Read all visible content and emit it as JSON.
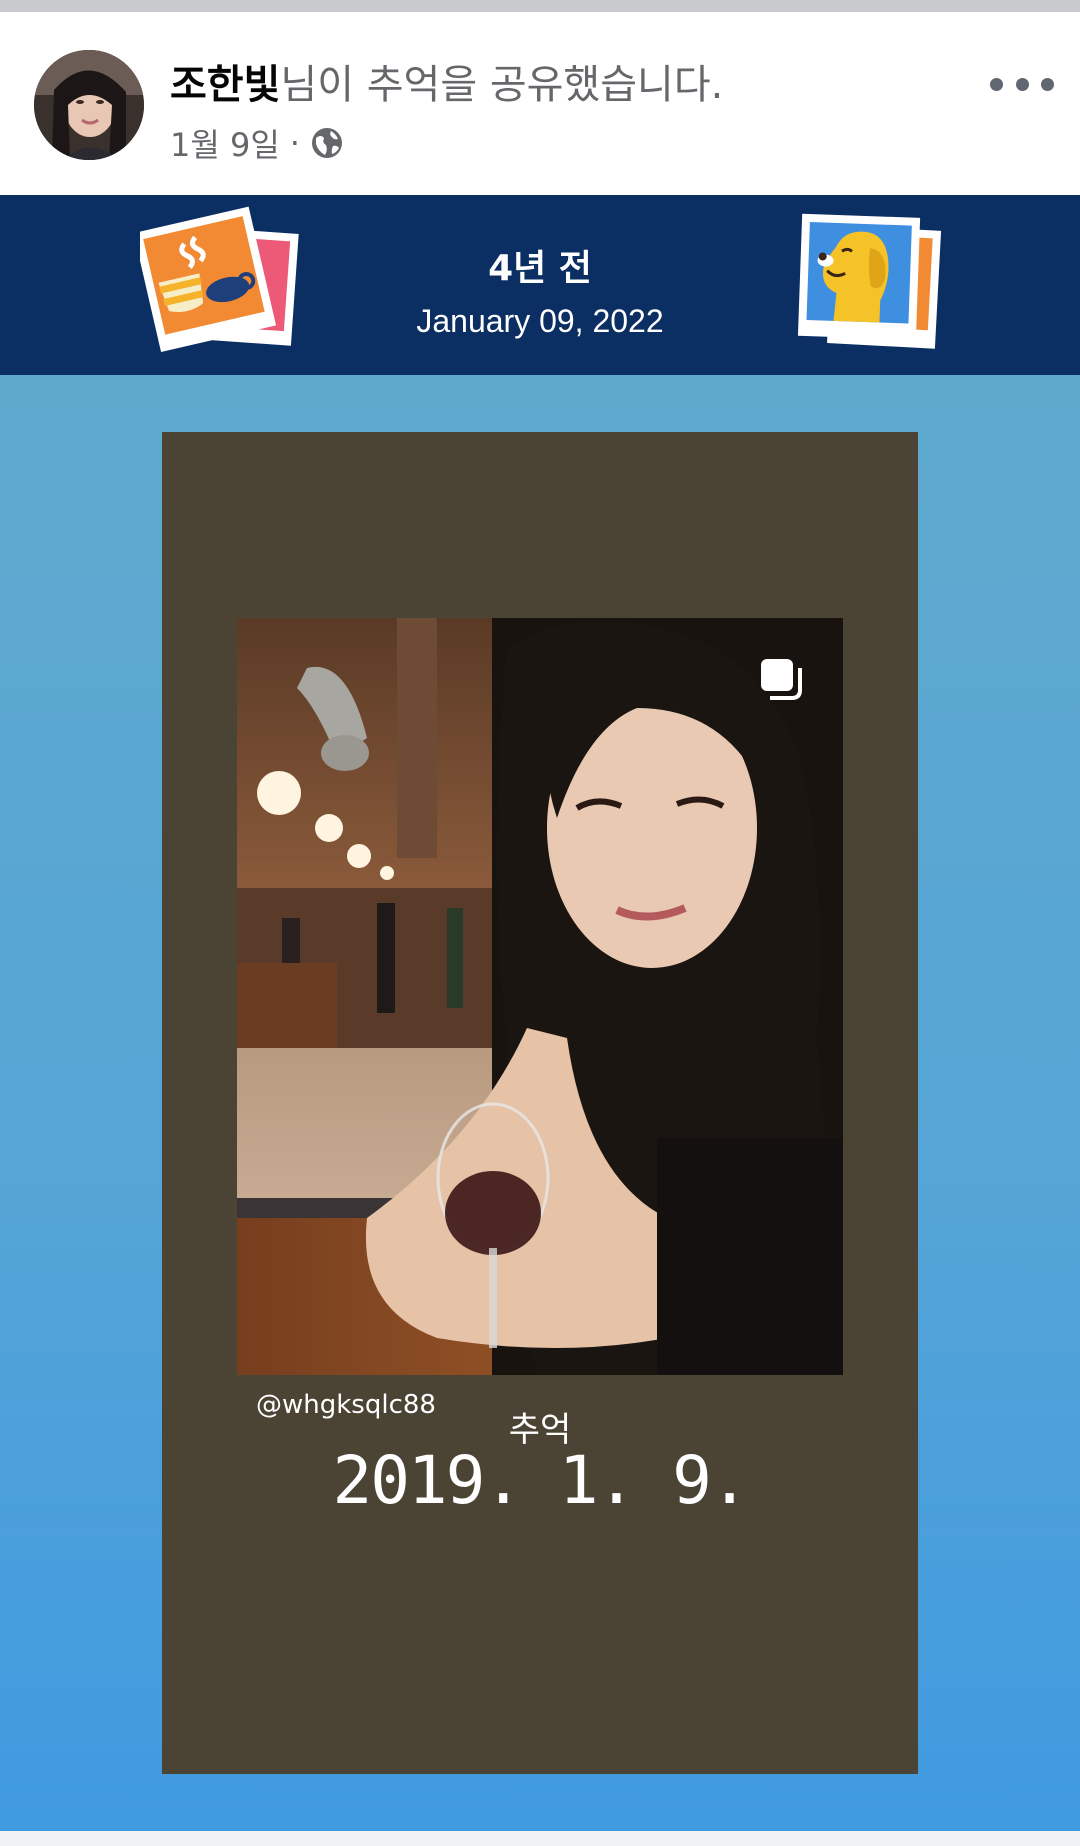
{
  "post": {
    "author_name": "조한빛",
    "action_text": "님이 추억을 공유했습니다.",
    "date": "1월 9일",
    "separator": "·",
    "privacy_icon": "globe-icon",
    "more_icon": "more-icon"
  },
  "memory_banner": {
    "years_ago": "4년 전",
    "date": "January 09, 2022",
    "left_sticker": "coffee-cup-photo-icon",
    "right_sticker": "dog-photo-icon"
  },
  "story": {
    "handle": "@whgksqlc88",
    "label": "추억",
    "date": "2019. 1. 9.",
    "multi_photo_icon": "multi-photo-icon"
  },
  "colors": {
    "banner": "#0b2f63",
    "card": "#4b4334",
    "gradient_top": "#5fa9cd",
    "gradient_bottom": "#409ae0"
  }
}
